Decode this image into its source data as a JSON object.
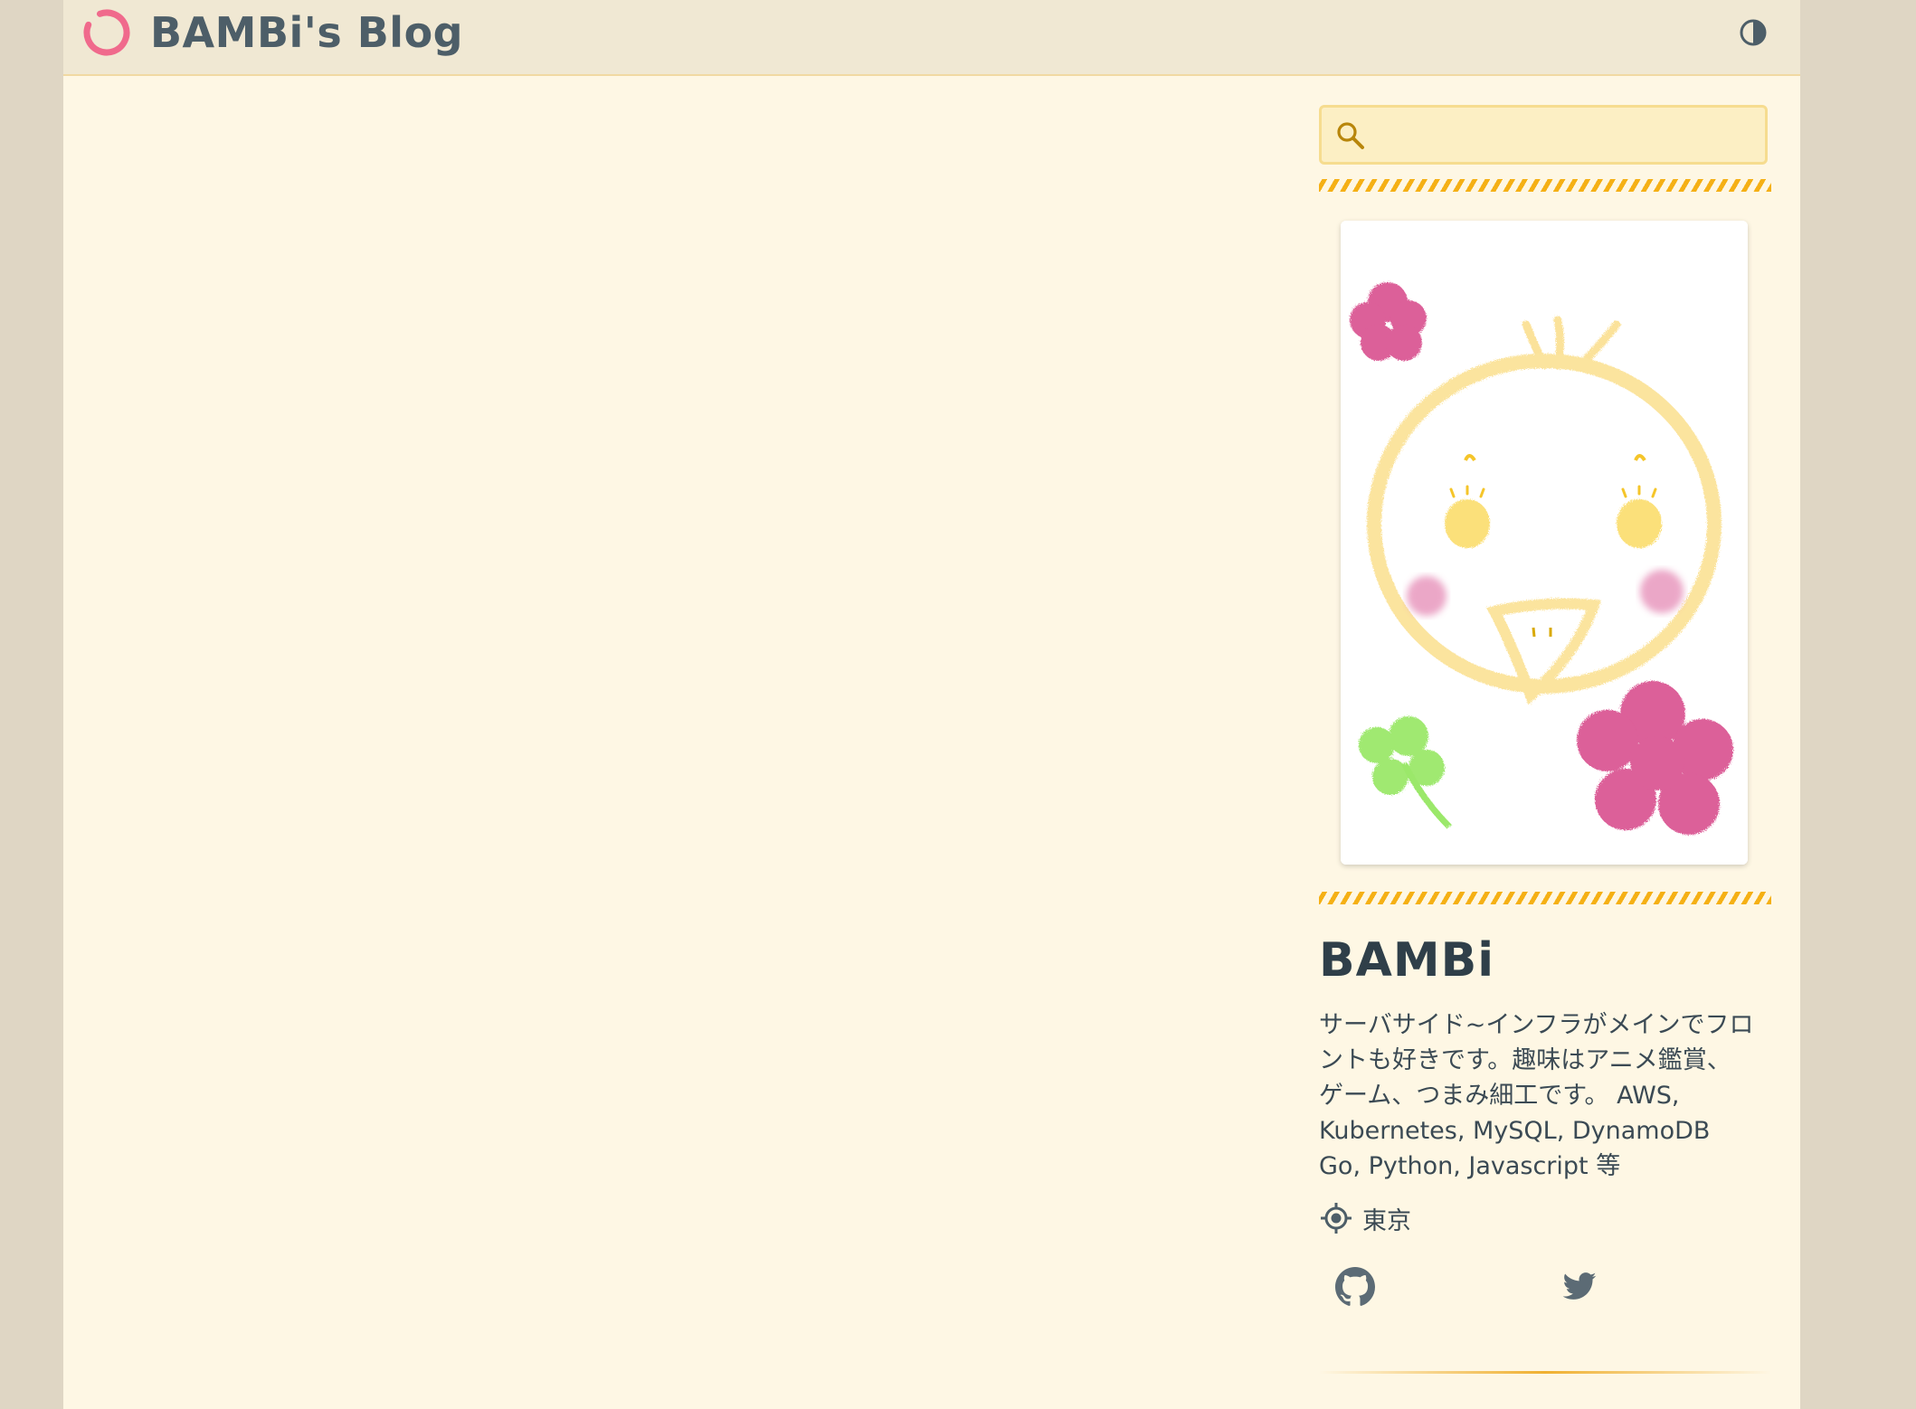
{
  "header": {
    "site_title": "BAMBi's Blog",
    "logo_icon": "pink-ring-logo-icon",
    "theme_toggle_icon": "contrast-half-circle-icon"
  },
  "sidebar": {
    "search": {
      "placeholder": "",
      "value": "",
      "icon": "search-icon"
    },
    "avatar": {
      "description": "drawing of a yellow chick face with pink flowers and a green clover"
    },
    "profile": {
      "name": "BAMBi",
      "bio_lines": [
        "サーバサイド~インフラがメインでフロ",
        "ントも好きです。趣味はアニメ鑑賞、",
        "ゲーム、つまみ細工です。 AWS,",
        "Kubernetes, MySQL, DynamoDB",
        "Go, Python, Javascript 等"
      ],
      "location": "東京",
      "location_icon": "location-target-icon"
    },
    "social": {
      "github_icon": "github-icon",
      "twitter_icon": "twitter-icon"
    }
  },
  "colors": {
    "page_background": "#fef7e4",
    "header_background": "#f0e8d3",
    "outer_background": "#dfd6c4",
    "accent_stripe": "#f5b015",
    "logo_pink": "#f06a8c",
    "text": "#3b4a54"
  }
}
